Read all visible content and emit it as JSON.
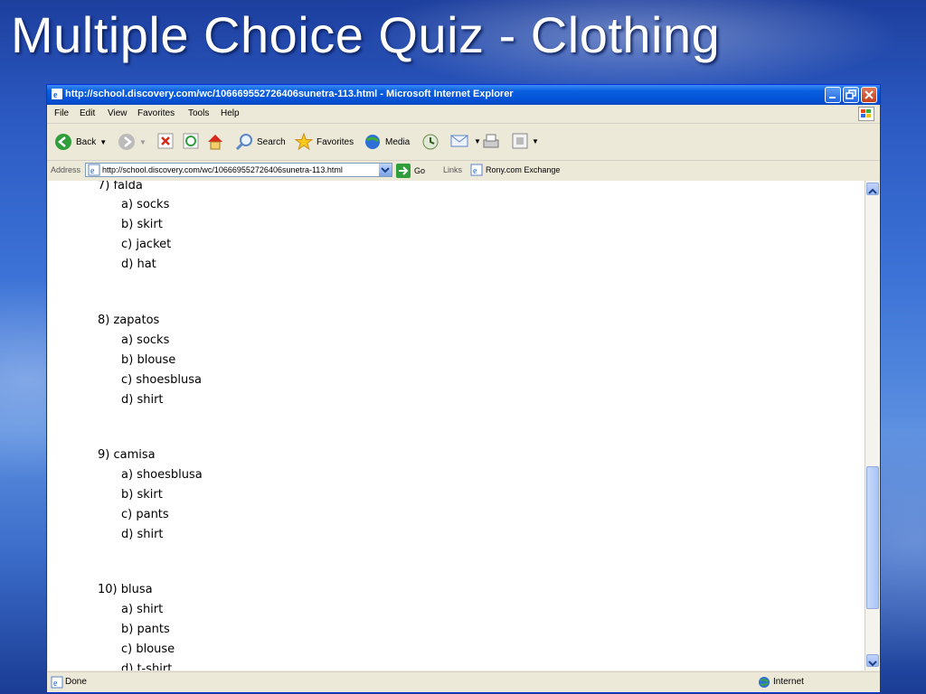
{
  "slide": {
    "title": "Multiple Choice Quiz - Clothing"
  },
  "window": {
    "title": "http://school.discovery.com/wc/106669552726406sunetra-113.html - Microsoft Internet Explorer",
    "menu": [
      "File",
      "Edit",
      "View",
      "Favorites",
      "Tools",
      "Help"
    ],
    "toolbar": {
      "back": "Back",
      "search": "Search",
      "favorites": "Favorites",
      "media": "Media"
    },
    "address": {
      "label": "Address",
      "url": "http://school.discovery.com/wc/106669552726406sunetra-113.html",
      "go": "Go",
      "links_label": "Links",
      "link1": "Rony.com Exchange"
    },
    "status": {
      "text": "Done",
      "zone": "Internet"
    }
  },
  "quiz": [
    {
      "question": "7) falda",
      "options": [
        "a) socks",
        "b) skirt",
        "c) jacket",
        "d) hat"
      ]
    },
    {
      "question": "8) zapatos",
      "options": [
        "a) socks",
        "b) blouse",
        "c) shoesblusa",
        "d) shirt"
      ]
    },
    {
      "question": "9) camisa",
      "options": [
        "a) shoesblusa",
        "b) skirt",
        "c) pants",
        "d) shirt"
      ]
    },
    {
      "question": "10) blusa",
      "options": [
        "a) shirt",
        "b) pants",
        "c) blouse",
        "d) t-shirt"
      ]
    }
  ],
  "colors": {
    "titlebar": "#0453d6",
    "chrome": "#ece9d8",
    "slide_bg": "#2c5bc4"
  }
}
